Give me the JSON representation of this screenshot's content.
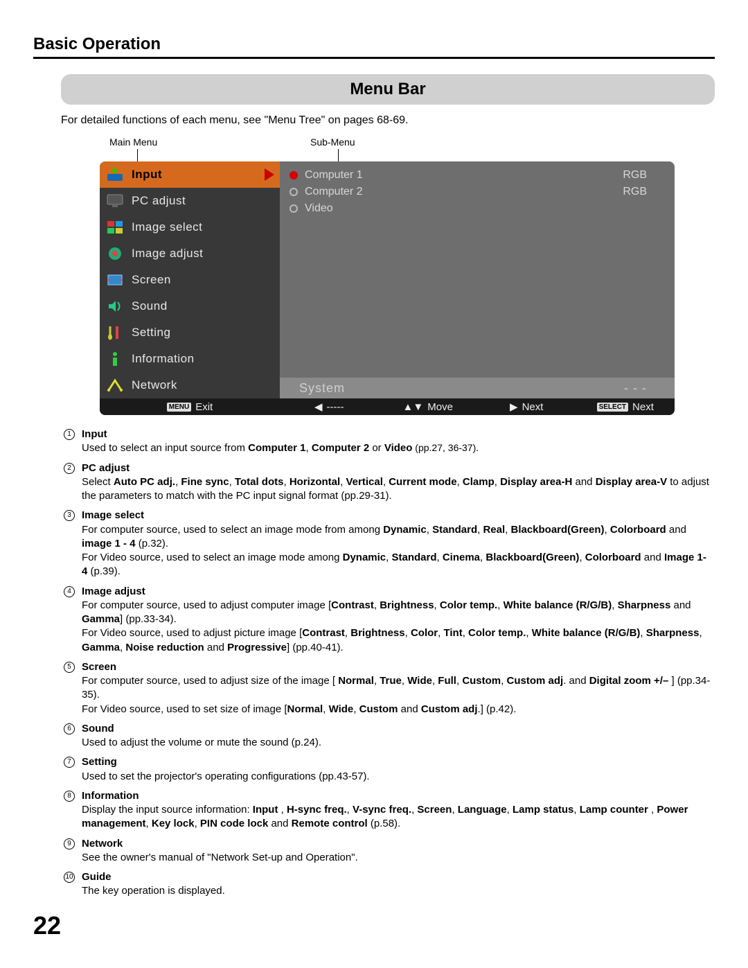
{
  "header": {
    "section": "Basic Operation"
  },
  "title": "Menu Bar",
  "intro": "For detailed functions of each menu, see \"Menu Tree\" on pages 68-69.",
  "labels": {
    "main": "Main Menu",
    "sub": "Sub-Menu"
  },
  "menu": {
    "items": [
      {
        "label": "Input",
        "selected": true
      },
      {
        "label": "PC adjust"
      },
      {
        "label": "Image select"
      },
      {
        "label": "Image adjust"
      },
      {
        "label": "Screen"
      },
      {
        "label": "Sound"
      },
      {
        "label": "Setting"
      },
      {
        "label": "Information"
      },
      {
        "label": "Network"
      }
    ]
  },
  "submenu": {
    "rows": [
      {
        "label": "Computer 1",
        "value": "RGB",
        "selected": true
      },
      {
        "label": "Computer 2",
        "value": "RGB",
        "selected": false
      },
      {
        "label": "Video",
        "value": "",
        "selected": false
      }
    ],
    "system": {
      "label": "System",
      "value": "- - -"
    }
  },
  "guide": {
    "exit_tag": "MENU",
    "exit": "Exit",
    "back": "-----",
    "move": "Move",
    "next1": "Next",
    "select_tag": "SELECT",
    "next2": "Next"
  },
  "numbers": [
    "①",
    "②",
    "③",
    "④",
    "⑤",
    "⑥",
    "⑦",
    "⑧",
    "⑨",
    "⑩"
  ],
  "desc": [
    {
      "n": "①",
      "title": "Input",
      "text_pre": "Used to select an input source from ",
      "bold": "Computer 1",
      "mid": ", ",
      "bold2": "Computer 2",
      "mid2": " or ",
      "bold3": "Video",
      "tail": " (pp.27, 36-37)."
    },
    {
      "n": "②",
      "title": "PC adjust",
      "html": "Select <b>Auto PC adj.</b>, <b>Fine sync</b>, <b>Total dots</b>, <b>Horizontal</b>, <b>Vertical</b>, <b>Current mode</b>, <b>Clamp</b>, <b>Display area-H</b> and <b>Display area-V</b> to adjust the parameters to match with the PC input signal format (pp.29-31)."
    },
    {
      "n": "③",
      "title": "Image select",
      "html": "For computer source, used to select an image mode from among <b>Dynamic</b>, <b>Standard</b>, <b>Real</b>, <b>Blackboard(Green)</b>, <b>Colorboard</b> and <b>image 1 - 4</b> (p.32).<br>For Video source, used to select an image mode among <b>Dynamic</b>, <b>Standard</b>, <b>Cinema</b>, <b>Blackboard(Green)</b>, <b>Colorboard</b> and <b>Image 1- 4</b> (p.39)."
    },
    {
      "n": "④",
      "title": "Image adjust",
      "html": "For computer source, used to adjust computer image [<b>Contrast</b>, <b>Brightness</b>, <b>Color temp.</b>, <b>White balance (R/G/B)</b>, <b>Sharpness</b> and <b>Gamma</b>] (pp.33-34).<br>For Video source, used to adjust picture image [<b>Contrast</b>, <b>Brightness</b>, <b>Color</b>, <b>Tint</b>, <b>Color temp.</b>, <b>White balance (R/G/B)</b>, <b>Sharpness</b>, <b>Gamma</b>, <b>Noise reduction</b> and <b>Progressive</b>] (pp.40-41)."
    },
    {
      "n": "⑤",
      "title": "Screen",
      "html": "For computer source, used to adjust size of the image [ <b>Normal</b>, <b>True</b>, <b>Wide</b>, <b>Full</b>, <b>Custom</b>, <b>Custom adj</b>. and <b>Digital zoom +/–</b> ] (pp.34-35).<br>For Video source, used to set size of image [<b>Normal</b>, <b>Wide</b>, <b>Custom</b> and <b>Custom adj</b>.] (p.42)."
    },
    {
      "n": "⑥",
      "title": "Sound",
      "html": "Used to adjust the volume or mute the sound (p.24)."
    },
    {
      "n": "⑦",
      "title": "Setting",
      "html": "Used to set the projector's operating configurations (pp.43-57)."
    },
    {
      "n": "⑧",
      "title": "Information",
      "html": "Display the input source information: <b>Input</b> , <b>H-sync freq.</b>, <b>V-sync freq.</b>, <b>Screen</b>, <b>Language</b>, <b>Lamp status</b>, <b>Lamp counter</b> , <b>Power management</b>, <b>Key lock</b>, <b>PIN code lock</b> and <b>Remote control</b> (p.58)."
    },
    {
      "n": "⑨",
      "title": "Network",
      "html": "See the owner's manual of \"Network Set-up and Operation\"."
    },
    {
      "n": "⑩",
      "title": "Guide",
      "html": "The key operation is displayed."
    }
  ],
  "page_number": "22"
}
